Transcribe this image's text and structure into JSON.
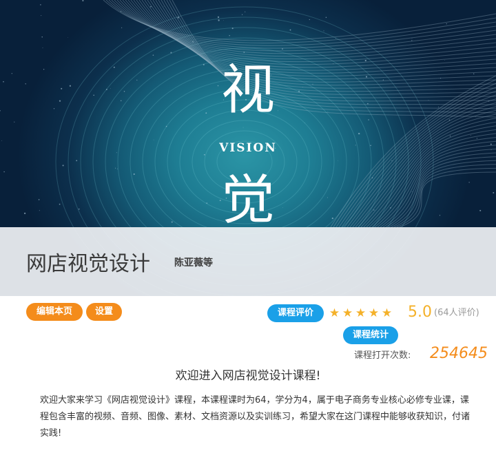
{
  "banner": {
    "char_top": "视",
    "word": "VISION",
    "char_bottom": "觉",
    "background_color": "#0c2f4c",
    "glow_color": "#2b95a6"
  },
  "course": {
    "title": "网店视觉设计",
    "author": "陈亚薇等"
  },
  "actions": {
    "edit_label": "编辑本页",
    "settings_label": "设置",
    "evaluation_label": "课程评价",
    "statistics_label": "课程统计"
  },
  "rating": {
    "stars": 5,
    "max_stars": 5,
    "score": "5.0",
    "review_count": "(64人评价)",
    "star_color": "#f4b12a"
  },
  "open_stats": {
    "label": "课程打开次数:",
    "count": "254645"
  },
  "welcome": "欢迎进入网店视觉设计课程!",
  "description": "欢迎大家来学习《网店视觉设计》课程，本课程课时为64，学分为4，属于电子商务专业核心必修专业课，课程包含丰富的视频、音频、图像、素材、文档资源以及实训练习，希望大家在这门课程中能够收获知识，付诸实践!",
  "colors": {
    "orange": "#f48c1b",
    "blue": "#1aa0e8"
  }
}
